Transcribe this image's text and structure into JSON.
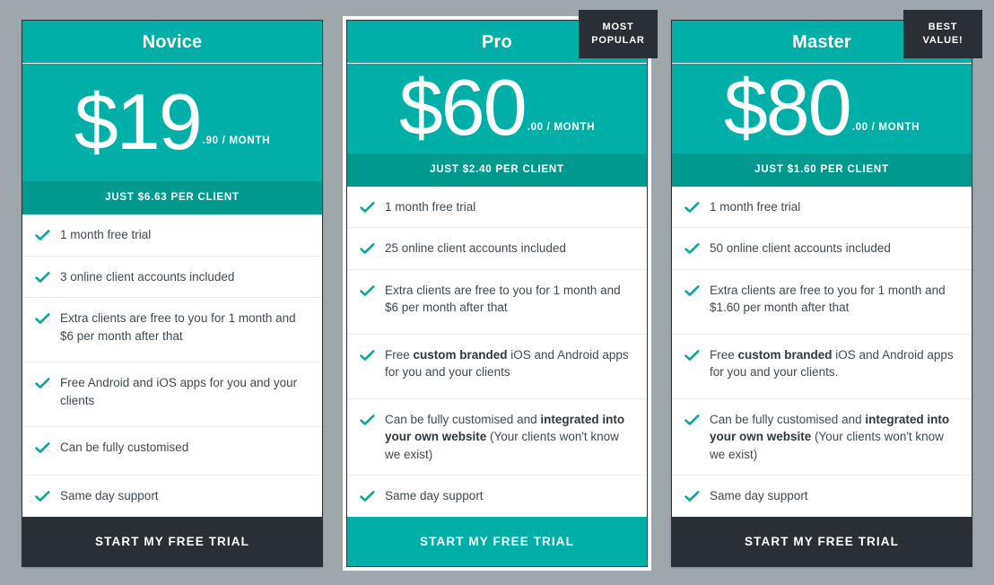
{
  "page": {
    "background_color": "#9ea8ac",
    "accent_color": "#00b0a8",
    "accent_dark_color": "#009990",
    "dark_color": "#292f35"
  },
  "plans": [
    {
      "name": "Novice",
      "badge": null,
      "price_main": "$19",
      "price_sub": ".90 / MONTH",
      "per_client": "JUST $6.63 PER CLIENT",
      "features": [
        "1 month free trial",
        "3 online client accounts included",
        "Extra clients are free to you for 1 month and $6 per month after that",
        "Free Android and iOS apps for you and your clients",
        "Can be fully customised",
        "Same day support"
      ],
      "cta": "START MY FREE TRIAL",
      "cta_style": "dark",
      "featured": false
    },
    {
      "name": "Pro",
      "badge": "MOST POPULAR",
      "price_main": "$60",
      "price_sub": ".00 / MONTH",
      "per_client": "JUST $2.40 PER CLIENT",
      "features": [
        "1 month free trial",
        "25 online client accounts included",
        "Extra clients are free to you for 1 month and $6 per month after that",
        "Free custom branded iOS and Android apps for you and your clients",
        "Can be fully customised and integrated into your own website (Your clients won't know we exist)",
        "Same day support"
      ],
      "features_bold": [
        null,
        null,
        null,
        "custom branded",
        "integrated into your own website"
      ],
      "cta": "START MY FREE TRIAL",
      "cta_style": "accent",
      "featured": true
    },
    {
      "name": "Master",
      "badge": "BEST VALUE!",
      "price_main": "$80",
      "price_sub": ".00 / MONTH",
      "per_client": "JUST $1.60 PER CLIENT",
      "features": [
        "1 month free trial",
        "50 online client accounts included",
        "Extra clients are free to you for 1 month and $1.60 per month after that",
        "Free custom branded iOS and Android apps for you and your clients.",
        "Can be fully customised and integrated into your own website (Your clients won't know we exist)",
        "Same day support"
      ],
      "features_bold": [
        null,
        null,
        null,
        "custom branded",
        "integrated into your own website"
      ],
      "cta": "START MY FREE TRIAL",
      "cta_style": "dark",
      "featured": false
    }
  ],
  "icons": {
    "check": "check-icon"
  }
}
